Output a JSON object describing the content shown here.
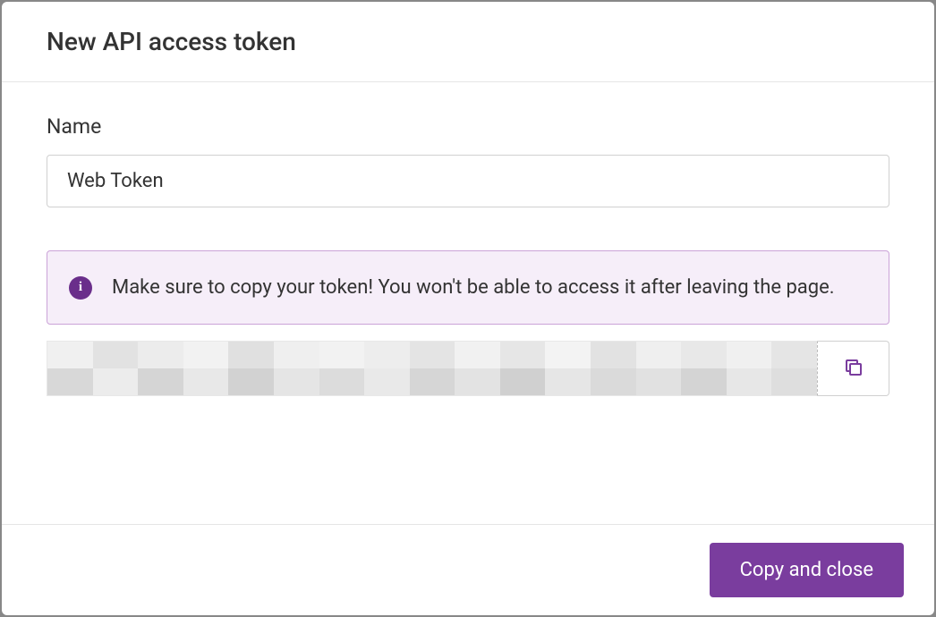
{
  "modal": {
    "title": "New API access token",
    "name_label": "Name",
    "name_value": "Web Token",
    "info_message": "Make sure to copy your token! You won't be able to access it after leaving the page.",
    "token_value_redacted": true,
    "copy_close_label": "Copy and close"
  }
}
